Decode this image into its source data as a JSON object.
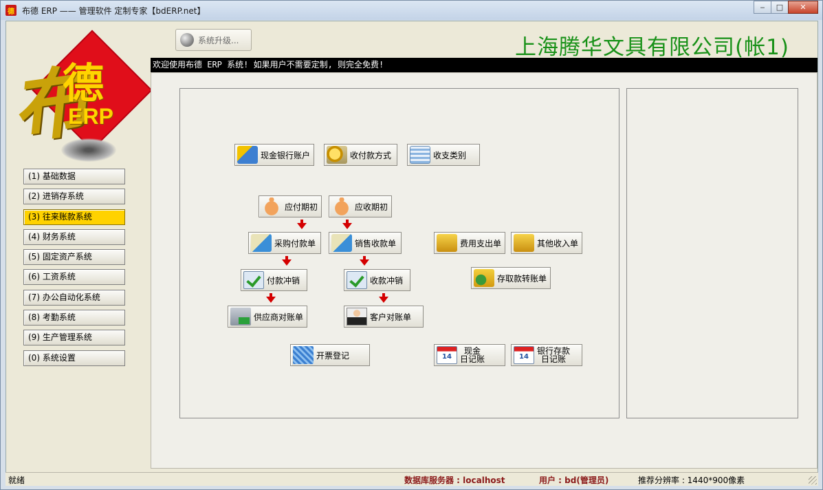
{
  "window": {
    "title": "布德 ERP —— 管理软件 定制专家【bdERP.net】",
    "icon_label": "德",
    "minimize": "‒",
    "maximize": "□",
    "close": "✕"
  },
  "logo": {
    "bu": "布",
    "de": "德",
    "erp": "ERP"
  },
  "sidebar": {
    "items": [
      {
        "label": "(1) 基础数据",
        "active": false
      },
      {
        "label": "(2) 进销存系统",
        "active": false
      },
      {
        "label": "(3) 往来账款系统",
        "active": true
      },
      {
        "label": "(4) 财务系统",
        "active": false
      },
      {
        "label": "(5) 固定资产系统",
        "active": false
      },
      {
        "label": "(6) 工资系统",
        "active": false
      },
      {
        "label": "(7) 办公自动化系统",
        "active": false
      },
      {
        "label": "(8) 考勤系统",
        "active": false
      },
      {
        "label": "(9) 生产管理系统",
        "active": false
      },
      {
        "label": "(0) 系统设置",
        "active": false
      }
    ]
  },
  "header": {
    "upgrade_label": "系统升级...",
    "company": "上海腾华文具有限公司(帐1)",
    "marquee": "欢迎使用布德 ERP 系统! 如果用户不需要定制, 则完全免费!"
  },
  "functions": {
    "cash_bank_account": "现金银行账户",
    "payment_method": "收付款方式",
    "income_expense_category": "收支类别",
    "payable_opening": "应付期初",
    "receivable_opening": "应收期初",
    "purchase_payment": "采购付款单",
    "sales_receipt": "销售收款单",
    "expense_bill": "费用支出单",
    "other_income": "其他收入单",
    "payment_writeoff": "付款冲销",
    "receipt_writeoff": "收款冲销",
    "deposit_transfer": "存取款转账单",
    "supplier_statement": "供应商对账单",
    "customer_statement": "客户对账单",
    "invoice_register": "开票登记",
    "cash_journal_1": "现金",
    "cash_journal_2": "日记账",
    "bank_journal_1": "银行存款",
    "bank_journal_2": "日记账"
  },
  "status": {
    "ready": "就绪",
    "db_server": "数据库服务器 : localhost",
    "user": "用户 : bd(管理员)",
    "resolution": "推荐分辨率 : 1440*900像素"
  },
  "colors": {
    "company_green": "#189118",
    "active_menu": "#ffd200",
    "arrow_red": "#d40000",
    "status_red": "#8b1a1a"
  }
}
